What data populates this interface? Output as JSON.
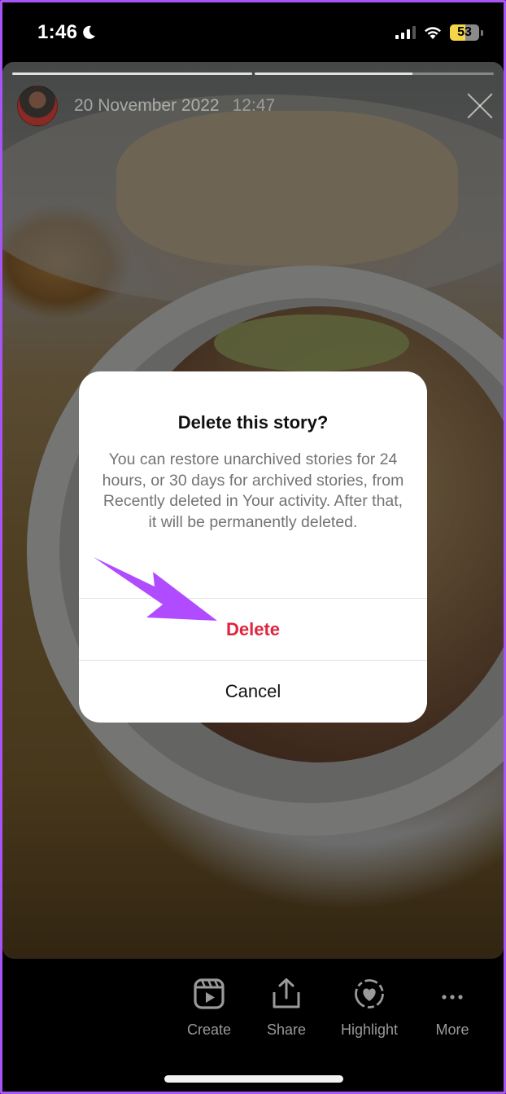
{
  "status_bar": {
    "time": "1:46",
    "focus_icon": "moon-icon",
    "signal_bars_active": 3,
    "signal_bars_total": 4,
    "wifi_icon": "wifi-icon",
    "battery_percent": "53",
    "battery_level": 0.53,
    "battery_color": "#f5d547"
  },
  "story": {
    "progress_segments": [
      {
        "fill": 1.0
      },
      {
        "fill": 0.66
      }
    ],
    "avatar_icon": "avatar",
    "date": "20 November 2022",
    "time": "12:47",
    "close_icon": "close-icon",
    "image_description": "blurred food photo: plate with stuffed bread and bowl of fruit with granola"
  },
  "dialog": {
    "title": "Delete this story?",
    "body": "You can restore unarchived stories for 24 hours, or 30 days for archived stories, from Recently deleted in Your activity. After that, it will be permanently deleted.",
    "delete_label": "Delete",
    "cancel_label": "Cancel",
    "delete_color": "#e0243e"
  },
  "annotation": {
    "arrow_icon": "arrow-pointer-icon",
    "arrow_color": "#b14bff",
    "points_to": "Delete"
  },
  "toolbar": {
    "items": [
      {
        "label": "Create",
        "icon": "reels-icon"
      },
      {
        "label": "Share",
        "icon": "share-icon"
      },
      {
        "label": "Highlight",
        "icon": "highlight-heart-icon"
      },
      {
        "label": "More",
        "icon": "more-dots-icon"
      }
    ]
  }
}
